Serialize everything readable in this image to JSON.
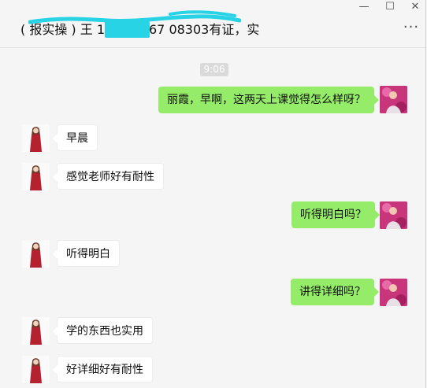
{
  "window": {
    "chat_title": "( 报实操 ) 王      1791  3567 08303有证，实",
    "min_glyph": "—",
    "max_glyph": "☐",
    "close_glyph": "✕",
    "more_glyph": "···"
  },
  "colors": {
    "outgoing_bubble": "#95ec69",
    "incoming_bubble": "#ffffff",
    "redaction": "#29d3e6",
    "background": "#f5f5f5"
  },
  "chat": {
    "timestamp": "9:06",
    "messages": [
      {
        "side": "out",
        "text": "丽霞，早啊，这两天上课觉得怎么样呀？"
      },
      {
        "side": "in",
        "text": "早晨"
      },
      {
        "side": "in",
        "text": "感觉老师好有耐性"
      },
      {
        "side": "out",
        "text": "听得明白吗？"
      },
      {
        "side": "in",
        "text": "听得明白"
      },
      {
        "side": "out",
        "text": "讲得详细吗？"
      },
      {
        "side": "in",
        "text": "学的东西也实用"
      },
      {
        "side": "in",
        "text": "好详细好有耐性"
      }
    ]
  }
}
